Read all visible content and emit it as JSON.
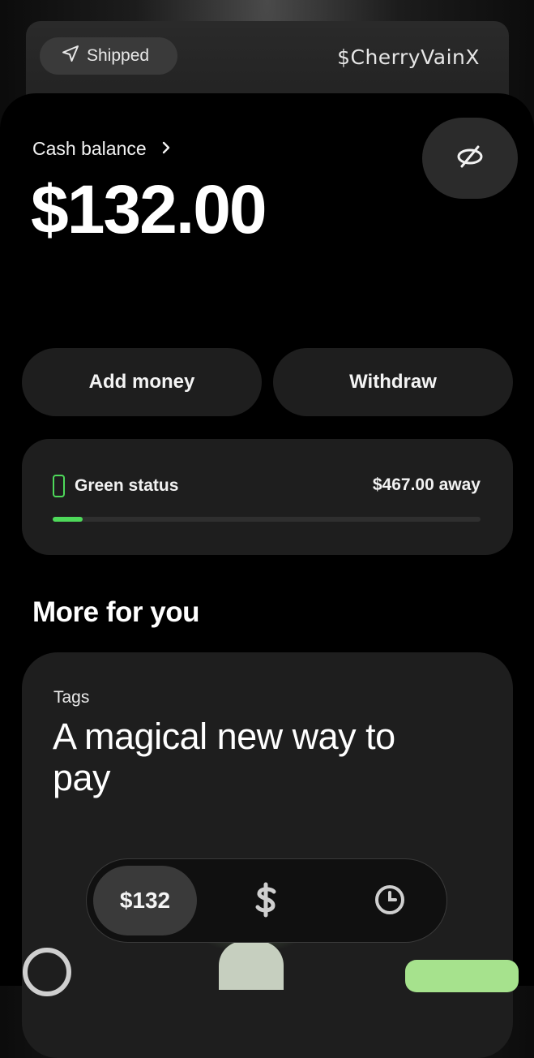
{
  "top": {
    "shipped_label": "Shipped",
    "cashtag": "$CherryVainX"
  },
  "balance": {
    "label": "Cash balance",
    "value": "$132.00"
  },
  "actions": {
    "add_money": "Add money",
    "withdraw": "Withdraw"
  },
  "status": {
    "label": "Green status",
    "away": "$467.00 away",
    "progress_fraction": 0.07
  },
  "more": {
    "title": "More for you"
  },
  "promo": {
    "kicker": "Tags",
    "headline": "A magical new way to pay"
  },
  "bottom_bar": {
    "balance": "$132",
    "icons": [
      "dollar-icon",
      "clock-icon"
    ]
  },
  "colors": {
    "accent_green": "#4ed95a",
    "card_bg": "#1e1e1e"
  }
}
